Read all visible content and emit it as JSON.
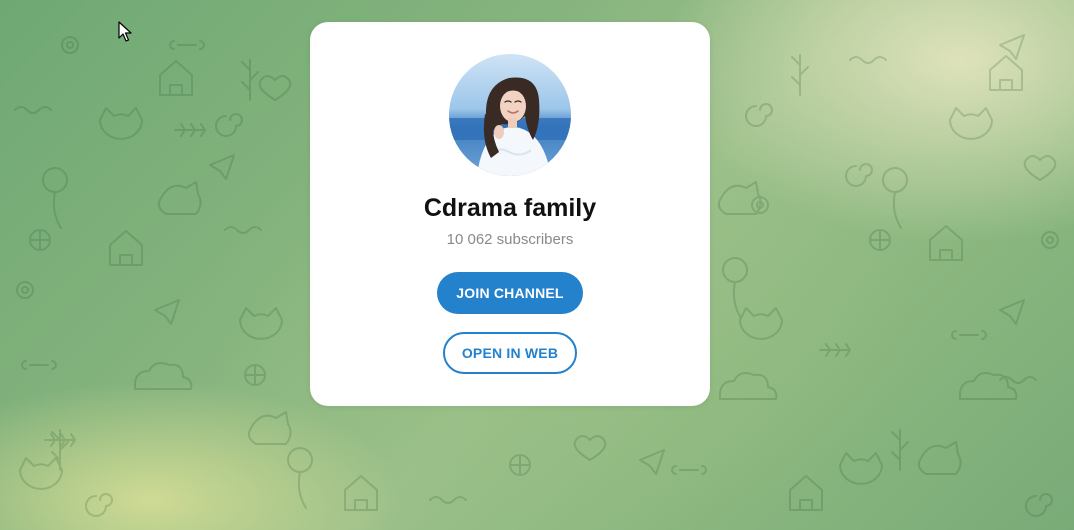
{
  "channel": {
    "title": "Cdrama family",
    "subscribers": "10 062 subscribers"
  },
  "actions": {
    "join_label": "JOIN CHANNEL",
    "web_label": "OPEN IN WEB"
  },
  "colors": {
    "accent": "#2481cc",
    "card_background": "#ffffff",
    "subtitle_text": "#8a8a8a",
    "background_green": "#86b47e"
  },
  "icons": {
    "background": "doodle-pattern",
    "pointer": "cursor-arrow-icon"
  }
}
